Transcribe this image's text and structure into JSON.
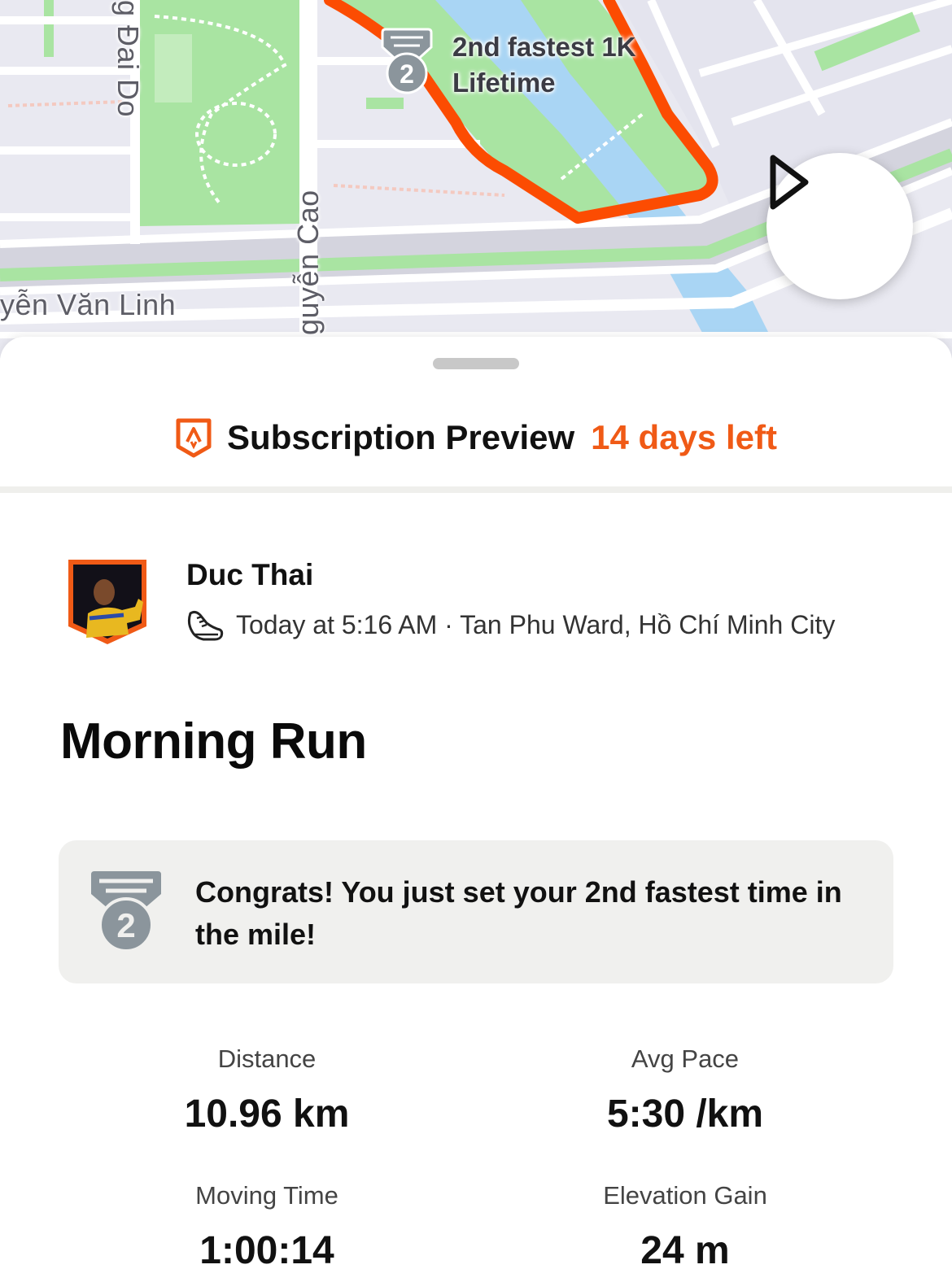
{
  "map": {
    "street_labels": {
      "dai_do": "g Đai Do",
      "van_linh": "yễn Văn Linh",
      "nguyen_cao": "guyễn Cao"
    },
    "segment_badge": {
      "line1": "2nd fastest 1K",
      "line2": "Lifetime",
      "icon": "silver-medal-icon",
      "rank": "2"
    },
    "play_button": {
      "icon": "play-icon"
    },
    "colors": {
      "route": "#fc4c02",
      "park": "#a9e4a2",
      "water": "#a9d5f4",
      "road": "#ffffff",
      "base": "#e9e9f1"
    }
  },
  "subscription": {
    "title": "Subscription Preview",
    "days_left": "14 days left",
    "icon": "strava-shield-icon",
    "accent": "#f05a16"
  },
  "athlete": {
    "name": "Duc Thai",
    "activity_icon": "running-shoe-icon",
    "meta": "Today at 5:16 AM · Tan Phu Ward, Hồ Chí Minh City"
  },
  "activity": {
    "title": "Morning Run"
  },
  "achievement": {
    "text": "Congrats! You just set your 2nd fastest time in the mile!",
    "icon": "silver-medal-icon",
    "rank": "2"
  },
  "stats": [
    {
      "label": "Distance",
      "value": "10.96 km"
    },
    {
      "label": "Avg Pace",
      "value": "5:30 /km"
    },
    {
      "label": "Moving Time",
      "value": "1:00:14"
    },
    {
      "label": "Elevation Gain",
      "value": "24 m"
    }
  ]
}
